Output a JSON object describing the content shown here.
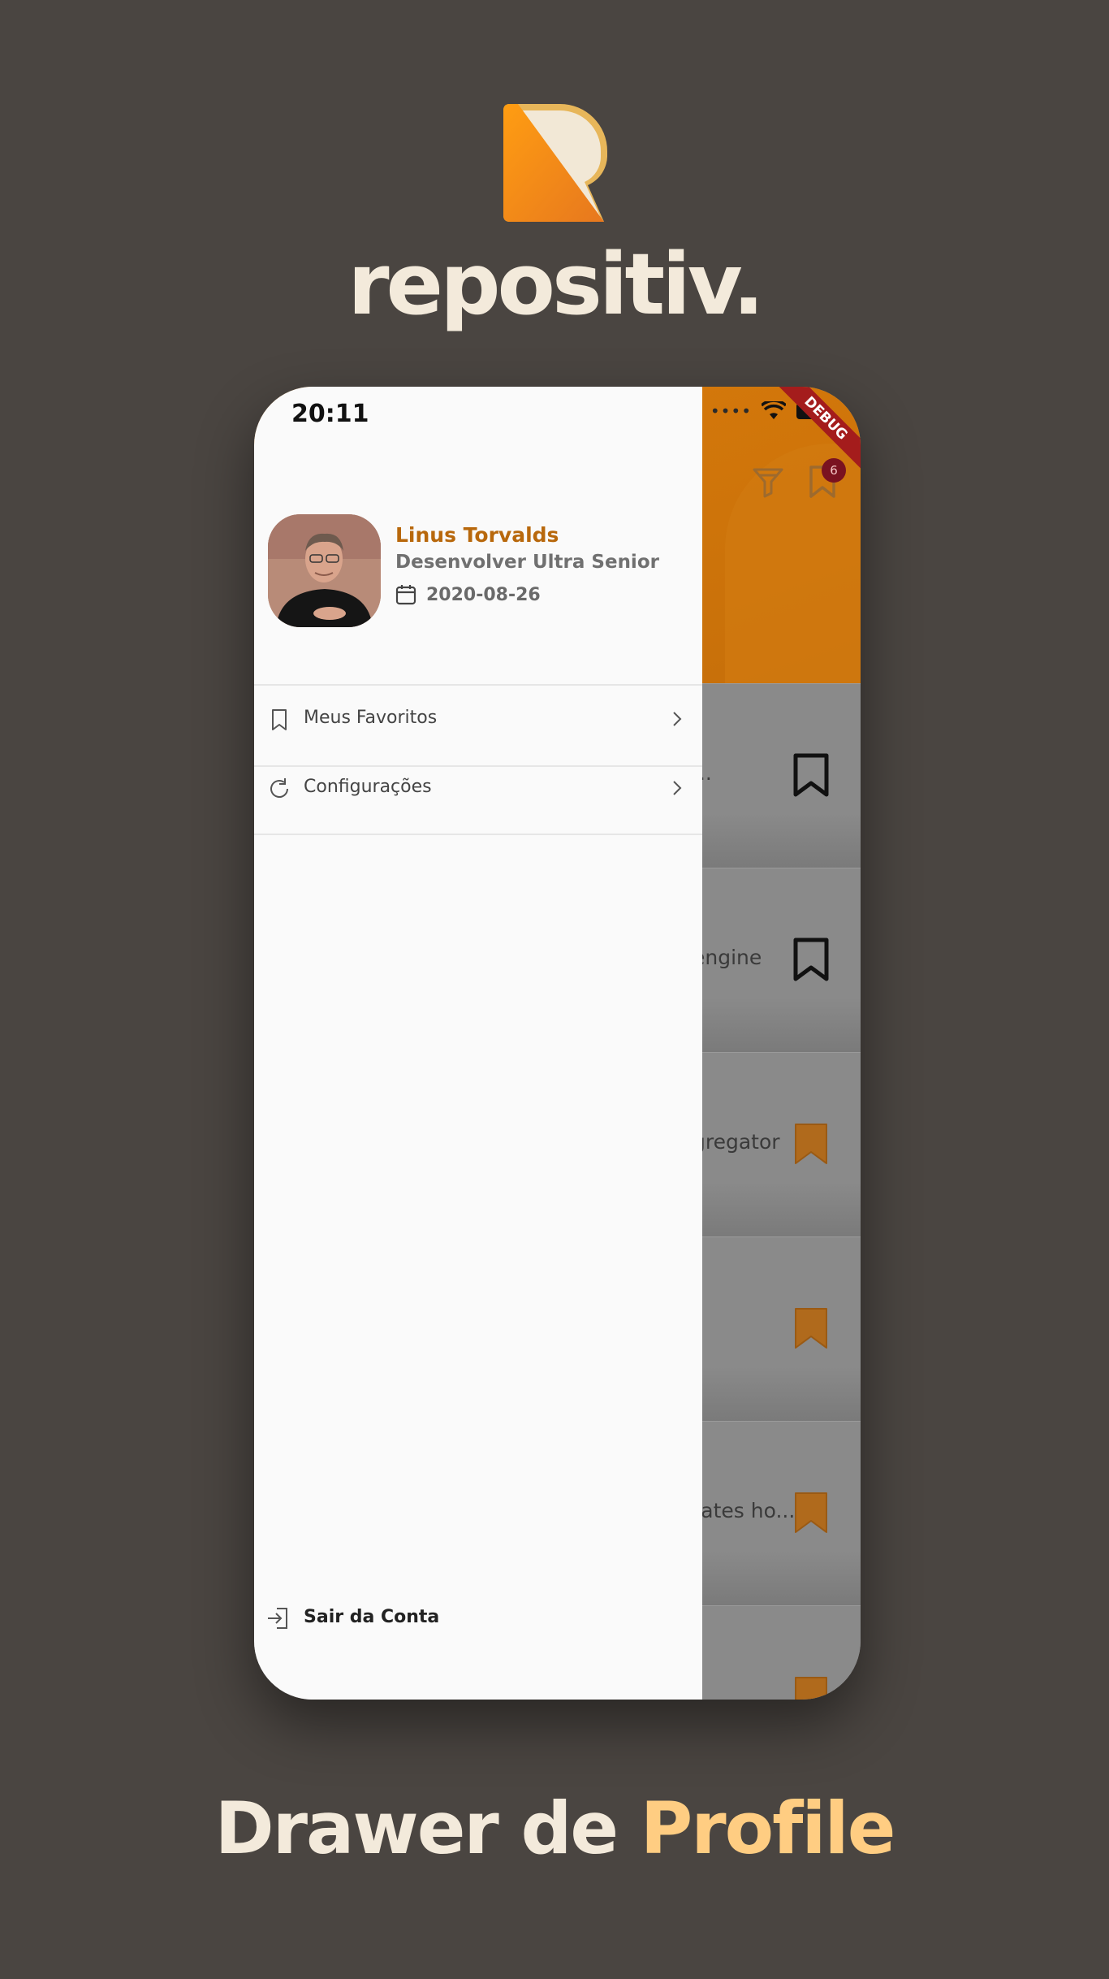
{
  "brand": {
    "name": "repositiv."
  },
  "caption": {
    "prefix": "Drawer de ",
    "highlight": "Profile"
  },
  "status": {
    "time": "20:11",
    "debug_label": "DEBUG"
  },
  "app_header": {
    "notification_count": "6"
  },
  "list_rows": [
    {
      "text": "...",
      "bookmarked": false
    },
    {
      "text": "engine",
      "bookmarked": false
    },
    {
      "text": "gregator",
      "bookmarked": true
    },
    {
      "text": "",
      "bookmarked": true
    },
    {
      "text": "rates ho...",
      "bookmarked": true
    },
    {
      "text": "",
      "bookmarked": true
    }
  ],
  "profile": {
    "name": "Linus Torvalds",
    "role": "Desenvolver Ultra Senior",
    "date": "2020-08-26"
  },
  "menu": {
    "items": [
      {
        "label": "Meus Favoritos",
        "icon": "bookmark-icon"
      },
      {
        "label": "Configurações",
        "icon": "refresh-icon"
      }
    ],
    "logout_label": "Sair da Conta"
  },
  "colors": {
    "background": "#4a4541",
    "accent_orange": "#b8680c",
    "caption_highlight": "#ffcd82",
    "bookmark_filled": "#b06a1c"
  }
}
